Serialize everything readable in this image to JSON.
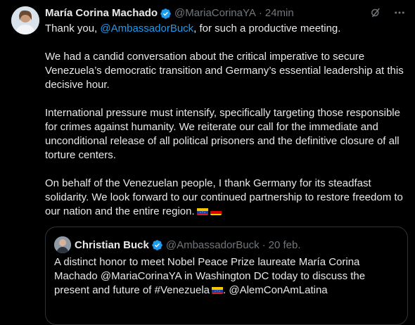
{
  "tweet": {
    "author_name": "María Corina Machado",
    "author_handle": "@MariaCorinaYA",
    "separator": "·",
    "time": "24min",
    "intro_prefix": "Thank you, ",
    "intro_mention": "@AmbassadorBuck",
    "intro_suffix": ", for such a productive meeting.",
    "paragraph_2": "We had a candid conversation about the critical imperative to secure Venezuela’s democratic transition and Germany’s essential leadership at this decisive hour.",
    "paragraph_3": "International pressure must intensify, specifically targeting those responsible for crimes against humanity. We reiterate our call for the immediate and unconditional release of all political prisoners and the definitive closure of all torture centers.",
    "paragraph_4": "On behalf of the Venezuelan people, I thank Germany for its steadfast solidarity. We look forward to our continued partnership to restore freedom to our nation and the entire region."
  },
  "quoted": {
    "author_name": "Christian Buck",
    "author_handle": "@AmbassadorBuck",
    "separator": "·",
    "time": "20 feb.",
    "text": "A distinct honor to meet Nobel Peace Prize laureate María Corina Machado @MariaCorinaYA in Washington DC today to discuss the present and future of #Venezuela",
    "text_suffix": ". @AlemConAmLatina"
  },
  "icons": {
    "verified": "verified-badge-icon",
    "grok": "grok-icon",
    "more": "more-icon",
    "flag_ve": "venezuela-flag-icon",
    "flag_de": "germany-flag-icon"
  },
  "colors": {
    "background": "#000000",
    "text": "#e7e9ea",
    "muted": "#71767b",
    "accent": "#1d9bf0",
    "border": "#2f3336"
  }
}
